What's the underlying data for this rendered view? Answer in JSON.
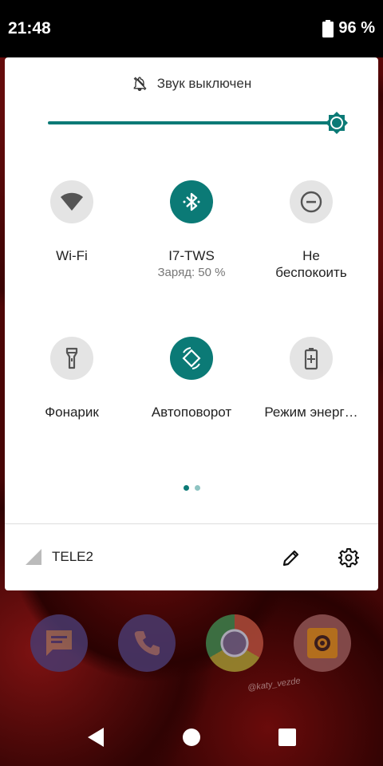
{
  "status_bar": {
    "time": "21:48",
    "battery": "96 %",
    "battery_icon": "battery-icon"
  },
  "quick_settings": {
    "sound_status": "Звук выключен",
    "sound_icon": "bell-off-icon",
    "brightness_level": 1.0,
    "accent_color": "#0b7a76",
    "tiles": [
      {
        "label": "Wi-Fi",
        "icon": "wifi-icon",
        "active": false
      },
      {
        "label": "I7-TWS",
        "sublabel": "Заряд: 50 %",
        "icon": "bluetooth-icon",
        "active": true
      },
      {
        "label": "Не\nбеспокоить",
        "icon": "do-not-disturb-icon",
        "active": false
      },
      {
        "label": "Фонарик",
        "icon": "flashlight-icon",
        "active": false
      },
      {
        "label": "Автоповорот",
        "icon": "auto-rotate-icon",
        "active": true
      },
      {
        "label": "Режим энерг…",
        "icon": "battery-saver-icon",
        "active": false
      }
    ],
    "page_dots": {
      "count": 2,
      "current": 1
    }
  },
  "footer": {
    "carrier": "TELE2",
    "signal_icon": "signal-icon",
    "edit_icon": "pencil-icon",
    "settings_icon": "gear-icon"
  },
  "dock": {
    "apps": [
      {
        "name": "messages",
        "icon": "messages-icon"
      },
      {
        "name": "phone",
        "icon": "phone-icon"
      },
      {
        "name": "chrome",
        "icon": "chrome-icon"
      },
      {
        "name": "camera",
        "icon": "camera-icon"
      }
    ],
    "watermark": "@katy_vezde"
  },
  "nav_bar": {
    "back_icon": "back-icon",
    "home_icon": "home-icon",
    "recents_icon": "recents-icon"
  }
}
